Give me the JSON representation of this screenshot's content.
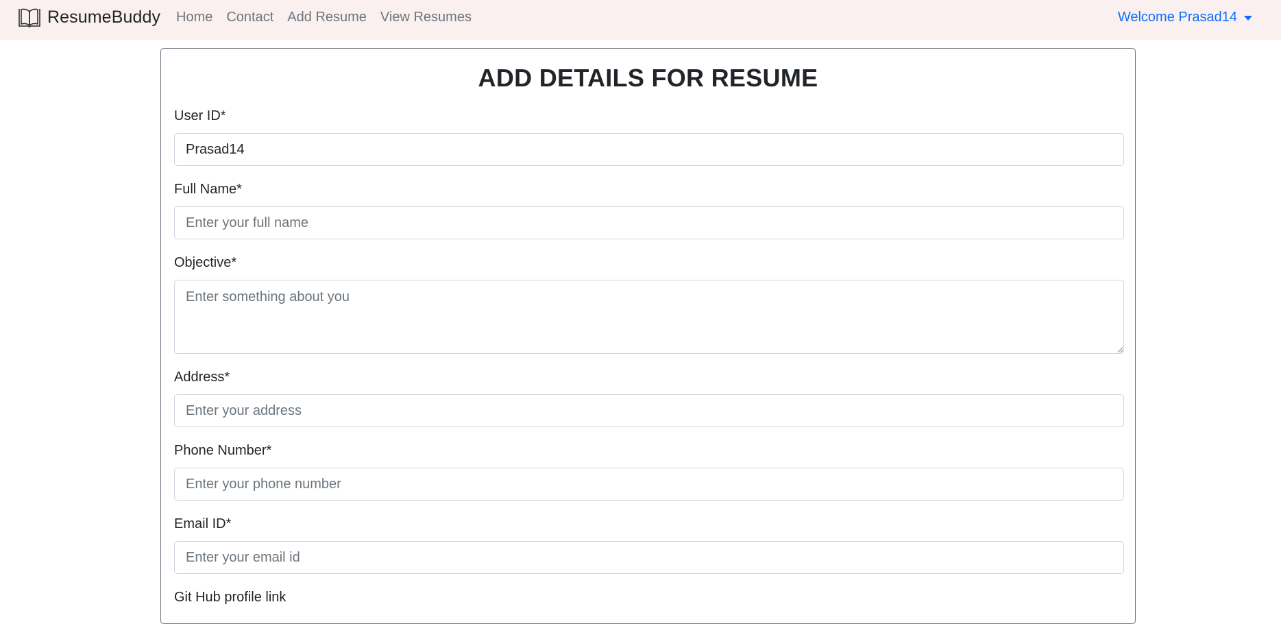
{
  "navbar": {
    "brand_icon": "open-book-icon",
    "brand": "ResumeBuddy",
    "links": [
      "Home",
      "Contact",
      "Add Resume",
      "View Resumes"
    ],
    "user_menu": "Welcome Prasad14"
  },
  "form": {
    "title": "ADD DETAILS FOR RESUME",
    "user_id": {
      "label": "User ID*",
      "value": "Prasad14"
    },
    "full_name": {
      "label": "Full Name*",
      "placeholder": "Enter your full name"
    },
    "objective": {
      "label": "Objective*",
      "placeholder": "Enter something about you"
    },
    "address": {
      "label": "Address*",
      "placeholder": "Enter your address"
    },
    "phone": {
      "label": "Phone Number*",
      "placeholder": "Enter your phone number"
    },
    "email": {
      "label": "Email ID*",
      "placeholder": "Enter your email id"
    },
    "github": {
      "label": "Git Hub profile link"
    }
  },
  "colors": {
    "navbar_bg": "#fbf0f0",
    "link_muted": "#6c757d",
    "accent": "#0d6efd"
  }
}
